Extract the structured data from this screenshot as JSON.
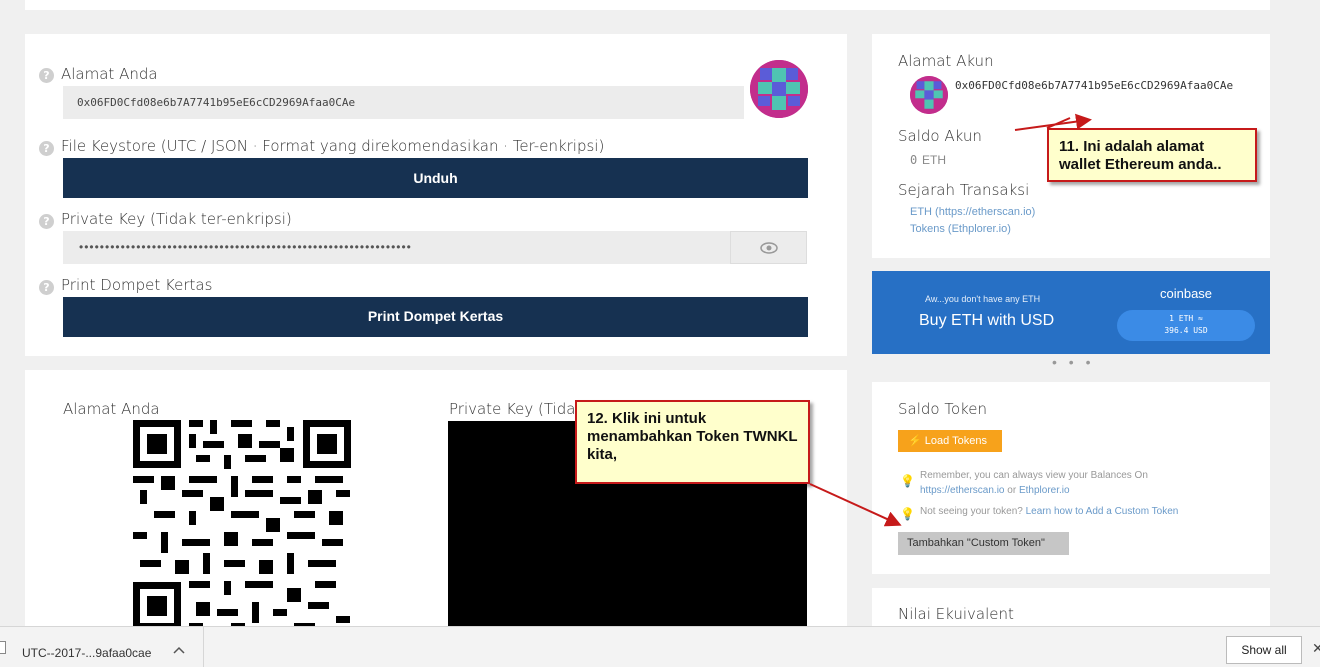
{
  "wallet": {
    "address_label": "Alamat Anda",
    "address_value": "0x06FD0Cfd08e6b7A7741b95eE6cCD2969Afaa0CAe",
    "keystore_label": "File Keystore (UTC / JSON · Format yang direkomendasikan · Ter-enkripsi)",
    "download_button": "Unduh",
    "private_key_label": "Private Key (Tidak ter-enkripsi)",
    "private_key_masked": "••••••••••••••••••••••••••••••••••••••••••••••••••••••••••••••••",
    "paper_label": "Print Dompet Kertas",
    "paper_button": "Print Dompet Kertas",
    "help_glyph": "?"
  },
  "print_card": {
    "address_label": "Alamat Anda",
    "private_key_label": "Private Key (Tidak"
  },
  "account": {
    "title": "Alamat Akun",
    "address": "0x06FD0Cfd08e6b7A7741b95eE6cCD2969Afaa0CAe",
    "balance_title": "Saldo Akun",
    "balance_value": "0",
    "balance_unit": "ETH",
    "history_title": "Sejarah Transaksi",
    "history_eth": "ETH (https://etherscan.io)",
    "history_tokens": "Tokens (Ethplorer.io)"
  },
  "coinbase": {
    "small_text": "Aw...you don't have any ETH",
    "big_text": "Buy ETH with USD",
    "logo": "coinbase",
    "rate_line1": "1 ETH ≈",
    "rate_line2": "396.4 USD",
    "dots": "• • •"
  },
  "token": {
    "title": "Saldo Token",
    "load_button": "Load Tokens",
    "note1_text": "Remember, you can always view your Balances On",
    "note1_link1": "https://etherscan.io",
    "note1_or": "or",
    "note1_link2": "Ethplorer.io",
    "note2_text": "Not seeing your token?",
    "note2_link": "Learn how to Add a Custom Token",
    "custom_button": "Tambahkan \"Custom Token\""
  },
  "equiv": {
    "title": "Nilai Ekuivalent"
  },
  "callouts": {
    "c11": "11. Ini adalah alamat wallet Ethereum anda..",
    "c12": "12. Klik ini untuk menambahkan Token TWNKL kita,"
  },
  "download_bar": {
    "file_name": "UTC--2017-...9afaa0cae",
    "show_all": "Show all",
    "close": "✕"
  },
  "colors": {
    "navy": "#163151",
    "coinbase_blue": "#2770c5",
    "orange": "#f7a21b",
    "callout_border": "#c61a1a",
    "callout_bg": "#ffffcc"
  }
}
